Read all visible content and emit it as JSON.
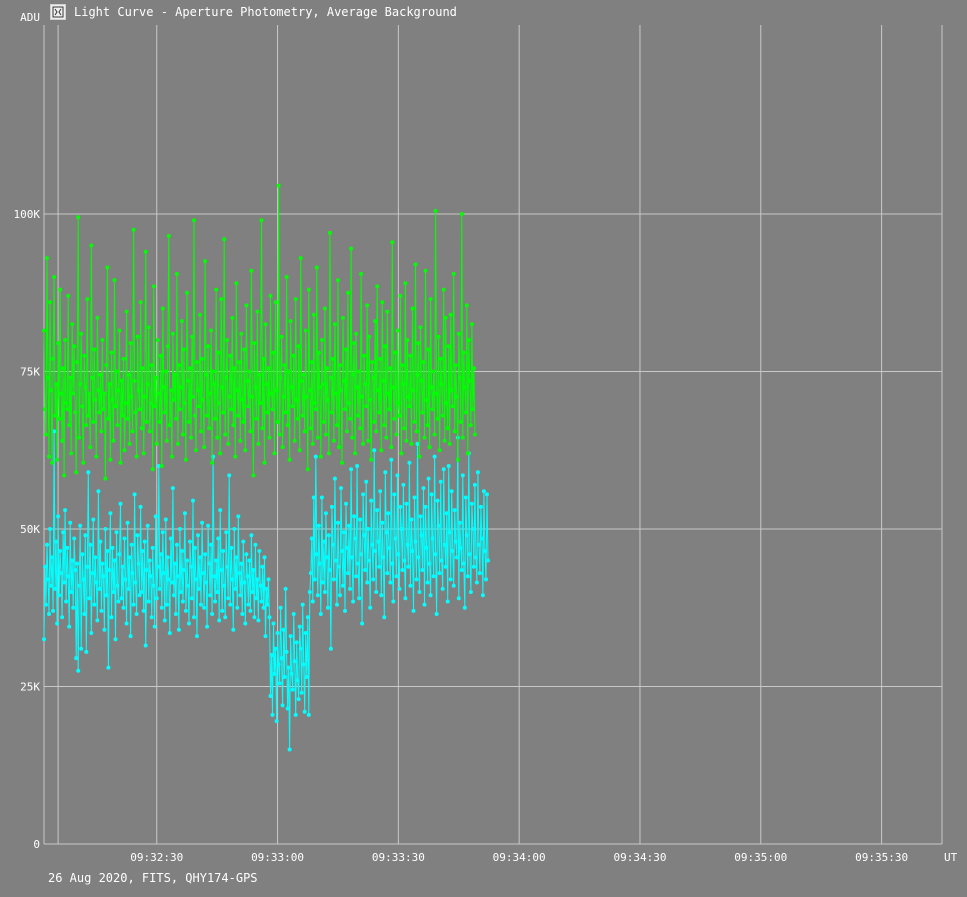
{
  "window": {
    "title": "Light Curve - Aperture Photometry, Average Background",
    "icon": "light-curve-app-icon"
  },
  "footer": {
    "info": "26 Aug 2020, FITS, QHY174-GPS"
  },
  "colors": {
    "background": "#808080",
    "grid": "#c8c8c8",
    "series_green": "#00ff00",
    "series_cyan": "#00ffff"
  },
  "chart_data": {
    "type": "line",
    "ylabel": "ADU",
    "xlabel": "UT",
    "grid": true,
    "ylim": [
      0,
      130000
    ],
    "xlim": [
      "09:32:02",
      "09:35:45"
    ],
    "yticks": [
      {
        "value": 0,
        "label": "0"
      },
      {
        "value": 25000,
        "label": "25K"
      },
      {
        "value": 50000,
        "label": "50K"
      },
      {
        "value": 75000,
        "label": "75K"
      },
      {
        "value": 100000,
        "label": "100K"
      }
    ],
    "xticks": [
      {
        "value": "09:32:30",
        "label": "09:32:30"
      },
      {
        "value": "09:33:00",
        "label": "09:33:00"
      },
      {
        "value": "09:33:30",
        "label": "09:33:30"
      },
      {
        "value": "09:34:00",
        "label": "09:34:00"
      },
      {
        "value": "09:34:30",
        "label": "09:34:30"
      },
      {
        "value": "09:35:00",
        "label": "09:35:00"
      },
      {
        "value": "09:35:30",
        "label": "09:35:30"
      }
    ],
    "series": [
      {
        "color": "#00ff00",
        "sampling": "1 sample every 0.25 s starting 09:32:02",
        "values": [
          81500,
          69000,
          65000,
          93000,
          74000,
          61500,
          86000,
          72000,
          60500,
          77000,
          90000,
          68000,
          73000,
          61000,
          79500,
          67500,
          88000,
          71500,
          64000,
          75500,
          58500,
          80000,
          70000,
          69000,
          87000,
          66500,
          74000,
          62000,
          82500,
          71500,
          79000,
          68500,
          59000,
          76500,
          99500,
          64500,
          73000,
          81000,
          69500,
          60500,
          77500,
          72500,
          66500,
          86500,
          68000,
          71500,
          63000,
          95000,
          74000,
          67000,
          78500,
          70500,
          61500,
          83500,
          72000,
          68500,
          74500,
          65500,
          80000,
          69000,
          71500,
          58000,
          76000,
          91500,
          67500,
          73000,
          61000,
          78000,
          70500,
          64000,
          89500,
          69500,
          75000,
          66500,
          72000,
          81500,
          60500,
          73500,
          68000,
          77000,
          62500,
          70000,
          84500,
          67500,
          74500,
          63500,
          79500,
          71000,
          65500,
          97500,
          73500,
          68500,
          61500,
          80500,
          72000,
          69000,
          86000,
          66000,
          75500,
          62000,
          71000,
          94000,
          67000,
          73000,
          82000,
          65500,
          70000,
          76000,
          59500,
          88500,
          69500,
          74000,
          63500,
          80000,
          71500,
          67000,
          77500,
          60000,
          85000,
          72500,
          68500,
          75000,
          64000,
          79000,
          96500,
          66500,
          72000,
          61500,
          81000,
          70500,
          74500,
          67500,
          90500,
          63500,
          76000,
          69000,
          72500,
          83000,
          65000,
          78500,
          70000,
          61000,
          87500,
          73500,
          67000,
          75500,
          64500,
          80500,
          71000,
          99000,
          68000,
          62500,
          76500,
          72000,
          69500,
          84000,
          65500,
          77000,
          70500,
          63000,
          92500,
          74500,
          68000,
          79000,
          66000,
          71500,
          81500,
          60500,
          75000,
          73000,
          67500,
          88000,
          64500,
          78000,
          70000,
          62000,
          86500,
          72500,
          68500,
          96000,
          65000,
          74000,
          80000,
          63500,
          71000,
          77500,
          69000,
          83500,
          66500,
          75500,
          61500,
          89000,
          72000,
          68000,
          76500,
          64000,
          81000,
          70500,
          67000,
          78500,
          62500,
          85500,
          73500,
          69500,
          75000,
          65500,
          91000,
          71000,
          58500,
          79500,
          72500,
          67500,
          84500,
          63500,
          74500,
          70000,
          99000,
          66000,
          77000,
          60500,
          82500,
          73000,
          68500,
          75500,
          64500,
          87000,
          71500,
          69000,
          78000,
          62000,
          86000,
          72000,
          67000,
          104500,
          65000,
          74000,
          80500,
          63000,
          71000,
          76000,
          68500,
          90000,
          66500,
          75000,
          61000,
          83000,
          72500,
          69500,
          77500,
          64000,
          86500,
          70500,
          67500,
          79000,
          62500,
          93000,
          73500,
          68000,
          74500,
          65500,
          81500,
          71000,
          59500,
          88000,
          72000,
          66000,
          76500,
          63500,
          84000,
          70000,
          69000,
          91500,
          64500,
          78000,
          72500,
          61500,
          80000,
          73000,
          67000,
          85000,
          65000,
          75500,
          70500,
          62000,
          97000,
          74000,
          68500,
          77000,
          64000,
          82500,
          71500,
          66500,
          89500,
          63000,
          76000,
          72000,
          60500,
          83500,
          73500,
          69000,
          78500,
          65500,
          87500,
          70000,
          67500,
          94500,
          64500,
          74500,
          79500,
          62000,
          81000,
          72500,
          68000,
          75000,
          66000,
          90500,
          71000,
          63500,
          77500,
          73000,
          69500,
          85500,
          64000,
          80500,
          70500,
          61000,
          76500,
          74000,
          67000,
          83000,
          65500,
          88500,
          72000,
          68500,
          77000,
          62500,
          86000,
          73500,
          66500,
          79000,
          64500,
          84500,
          71500,
          69000,
          75500,
          63000,
          95500,
          72500,
          67500,
          78000,
          65000,
          81500,
          70000,
          68000,
          87000,
          62000,
          76000,
          73000,
          66000,
          89000,
          64000,
          80000,
          71000,
          69500,
          77500,
          63500,
          85000,
          72000,
          67000,
          92000,
          65500,
          74500,
          79500,
          61500,
          82000,
          73500,
          68500,
          76500,
          64500,
          91000,
          70500,
          66500,
          78500,
          63000,
          86500,
          72500,
          69000,
          75000,
          65000,
          100500,
          71500,
          67500,
          80500,
          62500,
          77000,
          73000,
          68000,
          88000,
          64000,
          83500,
          70000,
          66000,
          79000,
          63500,
          84000,
          72000,
          69500,
          90500,
          65500,
          76000,
          71000,
          61000,
          81000,
          74000,
          67000,
          100000,
          64500,
          78000,
          72500,
          68500,
          85500,
          62000,
          80000,
          73500,
          66500,
          82500,
          69000,
          75500,
          65000
        ]
      },
      {
        "color": "#00ffff",
        "sampling": "1 sample every 0.25 s starting 09:32:02",
        "values": [
          32500,
          44000,
          38000,
          47500,
          42000,
          36500,
          50000,
          41000,
          45500,
          37000,
          65500,
          40500,
          48000,
          35000,
          52000,
          39500,
          46500,
          43000,
          36000,
          49500,
          41500,
          53000,
          38500,
          47000,
          42500,
          34500,
          51000,
          40000,
          45000,
          37500,
          48500,
          43500,
          29500,
          44500,
          27500,
          41000,
          50500,
          31000,
          46000,
          42000,
          36500,
          49000,
          30500,
          44000,
          59000,
          39000,
          47500,
          33500,
          43000,
          51500,
          38000,
          45500,
          41500,
          35500,
          56000,
          40500,
          48000,
          37000,
          44500,
          42500,
          34000,
          50000,
          39500,
          46500,
          28000,
          43500,
          52500,
          36000,
          47000,
          40000,
          45000,
          32500,
          49500,
          41000,
          38500,
          46000,
          54000,
          39000,
          44000,
          37500,
          48500,
          42000,
          35000,
          51000,
          40500,
          45500,
          33000,
          47500,
          43000,
          38000,
          55500,
          41500,
          36500,
          49000,
          44500,
          39500,
          53500,
          40000,
          46500,
          37000,
          48000,
          31500,
          43500,
          50500,
          38500,
          45000,
          42500,
          36000,
          47000,
          41000,
          34500,
          52000,
          39000,
          44000,
          60000,
          40500,
          46000,
          37500,
          49500,
          43000,
          35500,
          51500,
          38000,
          45500,
          42000,
          33500,
          48500,
          41500,
          56500,
          39500,
          44500,
          36500,
          47500,
          42500,
          34000,
          50000,
          40000,
          46500,
          38500,
          43500,
          52500,
          37000,
          45000,
          41000,
          35000,
          48000,
          44000,
          39000,
          54500,
          36000,
          47000,
          42000,
          33000,
          49000,
          40500,
          45500,
          38000,
          51000,
          43000,
          37500,
          46000,
          41500,
          34500,
          50500,
          44500,
          39500,
          47500,
          36500,
          61500,
          42500,
          38500,
          45000,
          40000,
          48500,
          35500,
          53000,
          43500,
          37000,
          46500,
          41000,
          36000,
          49500,
          44000,
          39000,
          58500,
          38000,
          47000,
          42000,
          34000,
          50000,
          40500,
          45500,
          37500,
          52000,
          43000,
          39500,
          44500,
          36500,
          48000,
          41500,
          35000,
          46000,
          42500,
          38000,
          45000,
          37000,
          49000,
          40000,
          43500,
          36000,
          47500,
          39000,
          42000,
          35500,
          46500,
          41000,
          38500,
          44000,
          37500,
          45500,
          33000,
          40500,
          38000,
          42000,
          36000,
          23500,
          30000,
          20500,
          35000,
          27000,
          31000,
          19500,
          33500,
          28500,
          25500,
          37500,
          29500,
          22000,
          34000,
          26500,
          40500,
          30500,
          21500,
          28000,
          15000,
          33000,
          27000,
          24500,
          36500,
          29000,
          20500,
          32000,
          26000,
          23000,
          34500,
          31000,
          24000,
          38000,
          28500,
          21000,
          33500,
          26500,
          36000,
          20500,
          40000,
          43000,
          48500,
          38500,
          55000,
          42000,
          61500,
          46000,
          39500,
          50500,
          44500,
          36500,
          55000,
          41500,
          48000,
          40000,
          52500,
          45500,
          37500,
          49000,
          43500,
          31000,
          53500,
          47500,
          42000,
          58000,
          45000,
          38000,
          51000,
          44000,
          39500,
          56500,
          46500,
          41000,
          49500,
          37000,
          54000,
          47000,
          43000,
          50500,
          40500,
          59500,
          45500,
          38500,
          52000,
          48500,
          42500,
          60000,
          44500,
          39000,
          51500,
          46000,
          35000,
          55500,
          49000,
          43500,
          57500,
          41500,
          50000,
          45000,
          37500,
          54500,
          47500,
          42000,
          62500,
          46500,
          40000,
          53000,
          48000,
          44000,
          56000,
          39500,
          51000,
          45500,
          36000,
          59000,
          49500,
          43000,
          52500,
          47000,
          41500,
          61000,
          44500,
          38500,
          55500,
          48500,
          42500,
          58500,
          46000,
          40500,
          53500,
          50000,
          43500,
          57000,
          45000,
          39000,
          54000,
          47500,
          44000,
          60500,
          41000,
          51500,
          46500,
          37000,
          55000,
          48000,
          42000,
          63500,
          45500,
          40000,
          52000,
          49000,
          43500,
          56500,
          38000,
          53500,
          47000,
          41500,
          58000,
          44500,
          39500,
          55500,
          48500,
          42500,
          61500,
          46000,
          36500,
          54500,
          50500,
          43000,
          57500,
          45000,
          40500,
          59500,
          47500,
          44000,
          52500,
          38500,
          60000,
          49500,
          42000,
          56000,
          46500,
          41000,
          53000,
          48000,
          45500,
          64500,
          39000,
          51000,
          47000,
          43500,
          58500,
          44500,
          37500,
          55000,
          49000,
          42500,
          62000,
          46000,
          40000,
          54000,
          50000,
          44000,
          57000,
          45500,
          41500,
          59000,
          47500,
          43000,
          53500,
          48500,
          39500,
          56000,
          46500,
          42000,
          55500,
          45000
        ]
      }
    ]
  }
}
